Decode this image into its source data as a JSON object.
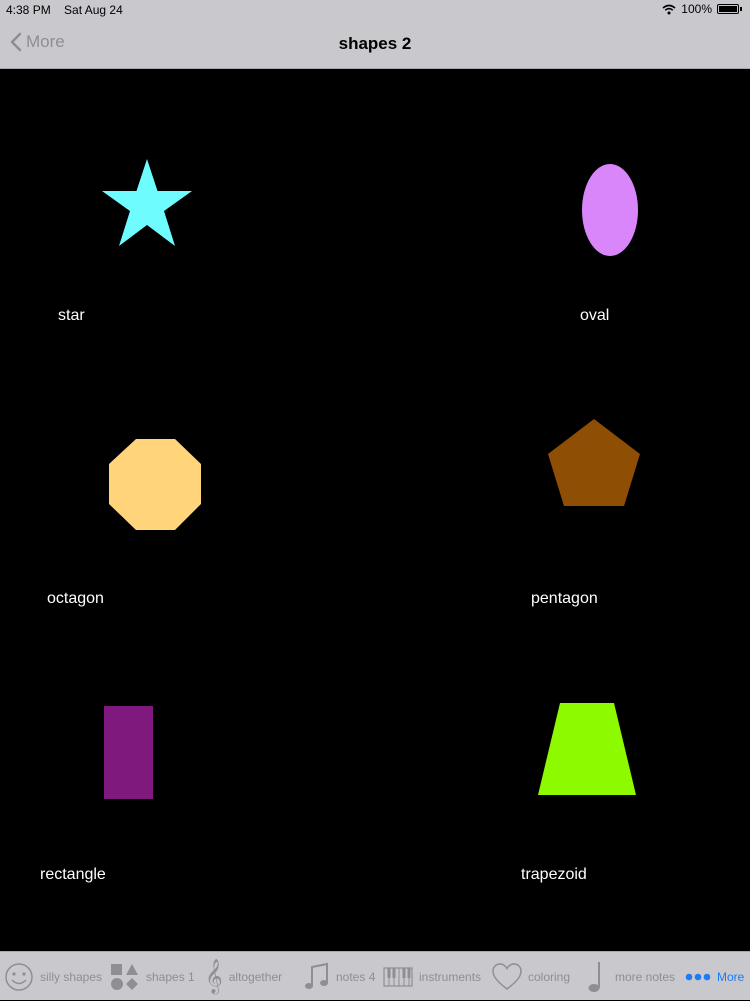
{
  "status": {
    "time": "4:38 PM",
    "date": "Sat Aug 24",
    "battery": "100%"
  },
  "nav": {
    "back_label": "More",
    "title": "shapes 2"
  },
  "shapes": [
    {
      "label": "star",
      "color": "#6ffcff"
    },
    {
      "label": "oval",
      "color": "#d986fb"
    },
    {
      "label": "octagon",
      "color": "#ffd47a"
    },
    {
      "label": "pentagon",
      "color": "#8e4f04"
    },
    {
      "label": "rectangle",
      "color": "#7f197d"
    },
    {
      "label": "trapezoid",
      "color": "#8dfa00"
    }
  ],
  "tabs": [
    {
      "label": "silly shapes",
      "icon": "smiley-icon"
    },
    {
      "label": "shapes 1",
      "icon": "shapes-icon"
    },
    {
      "label": "altogether",
      "icon": "treble-clef-icon"
    },
    {
      "label": "notes 4",
      "icon": "music-note-icon"
    },
    {
      "label": "instruments",
      "icon": "piano-icon"
    },
    {
      "label": "coloring",
      "icon": "heart-icon"
    },
    {
      "label": "more notes",
      "icon": "quarter-note-icon"
    },
    {
      "label": "More",
      "icon": "more-dots-icon",
      "active": true
    }
  ],
  "colors": {
    "bars": "#c9c8cd",
    "inactive": "#8e8e93",
    "accent": "#1a7cf7"
  }
}
